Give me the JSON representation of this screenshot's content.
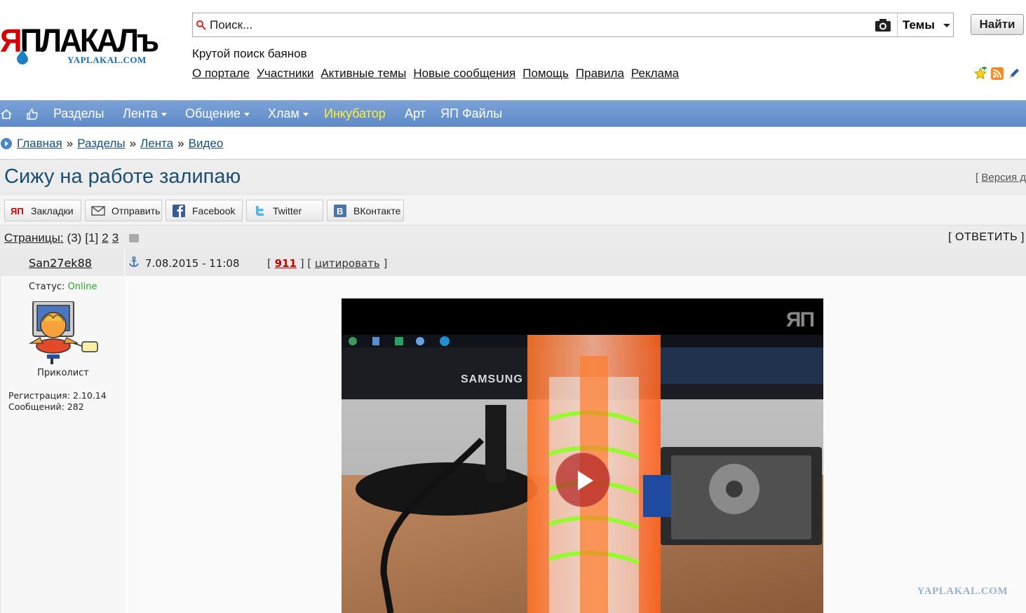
{
  "header": {
    "logo_text": "ЯПЛАКАЛъ",
    "logo_sub": "YAPLAKAL.COM",
    "search_placeholder": "Поиск...",
    "theme_select": "Темы",
    "find_button": "Найти",
    "cool_search": "Крутой поиск баянов",
    "links": [
      "О портале",
      "Участники",
      "Активные темы",
      "Новые сообщения",
      "Помощь",
      "Правила",
      "Реклама"
    ]
  },
  "nav": {
    "items": [
      {
        "label": "Разделы"
      },
      {
        "label": "Лента"
      },
      {
        "label": "Общение"
      },
      {
        "label": "Хлам"
      },
      {
        "label": "Инкубатор"
      },
      {
        "label": "Арт"
      },
      {
        "label": "ЯП Файлы"
      }
    ]
  },
  "breadcrumb": [
    "Главная",
    "Разделы",
    "Лента",
    "Видео"
  ],
  "breadcrumb_sep": "»",
  "topic": {
    "title": "Сижу на работе залипаю",
    "version_prefix": "[ ",
    "version_link": "Версия д"
  },
  "share": [
    "Закладки",
    "Отправить",
    "Facebook",
    "Twitter",
    "ВКонтакте"
  ],
  "pages": {
    "label": "Страницы:",
    "total": "(3)",
    "current": "[1]",
    "others": [
      "2",
      "3"
    ],
    "reply": "[ ОТВЕТИТЬ ]"
  },
  "post": {
    "author": "San27ek88",
    "date": "7.08.2015 - 11:08",
    "meta_open": "[ ",
    "rating": "911",
    "meta_mid": " ] [ ",
    "quote": "цитировать",
    "meta_close": " ]",
    "status_label": "Статус:",
    "status_value": "Online",
    "rank": "Приколист",
    "registration": "Регистрация: 2.10.14",
    "messages": "Сообщений: 282",
    "video_logo": "ЯП",
    "watermark": "YAPLAKAL.COM"
  },
  "colors": {
    "nav_bg": "#6b94cd",
    "title": "#1b4e73",
    "incubator": "#ffef3d",
    "online": "#27a227",
    "rating": "#c00000"
  }
}
